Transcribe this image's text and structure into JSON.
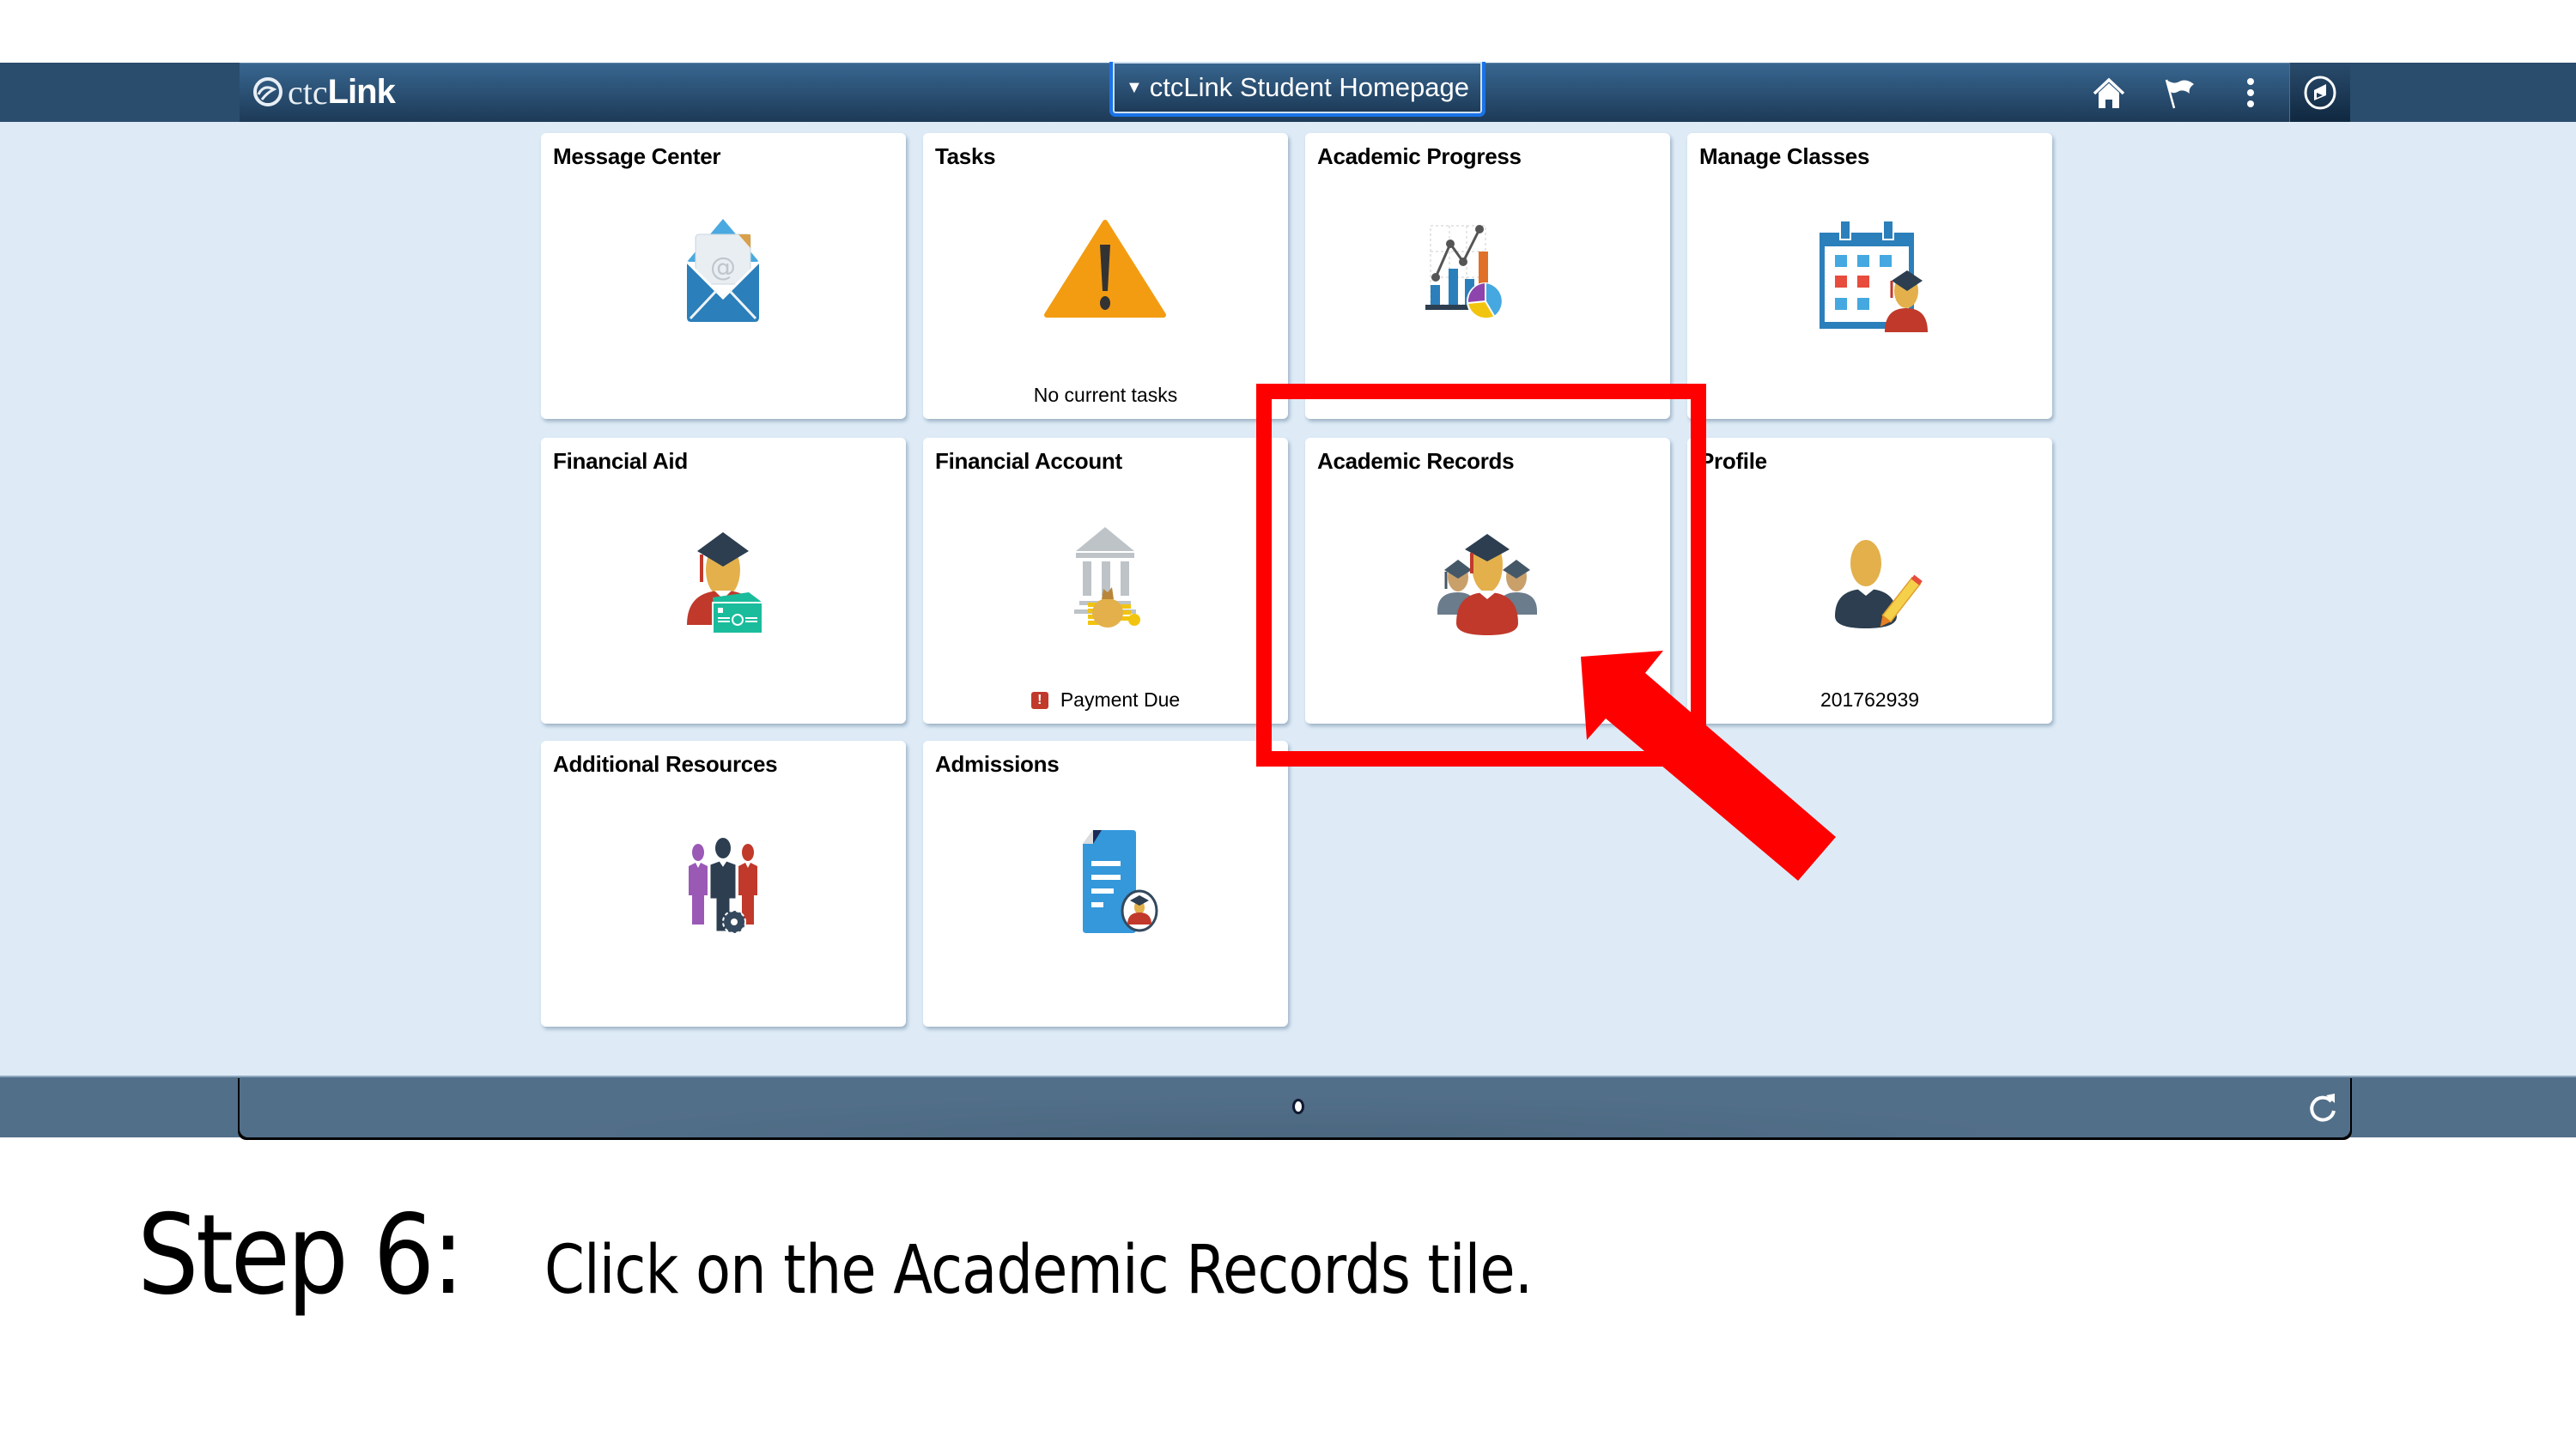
{
  "header": {
    "logo_swirl": "Θ",
    "logo_prefix": "ctc",
    "logo_suffix": "Link",
    "homepage_selector": "ctcLink Student Homepage",
    "icons": [
      "home-icon",
      "flag-icon",
      "actions-menu-icon",
      "navbar-compass-icon"
    ]
  },
  "tiles": [
    {
      "title": "Message Center",
      "icon": "envelope-icon",
      "footer": ""
    },
    {
      "title": "Tasks",
      "icon": "warning-icon",
      "footer": "No current tasks"
    },
    {
      "title": "Academic Progress",
      "icon": "chart-icon",
      "footer": ""
    },
    {
      "title": "Manage Classes",
      "icon": "calendar-student-icon",
      "footer": ""
    },
    {
      "title": "Financial Aid",
      "icon": "graduate-money-icon",
      "footer": ""
    },
    {
      "title": "Financial Account",
      "icon": "bank-icon",
      "footer": "Payment Due",
      "footer_alert": "!"
    },
    {
      "title": "Academic Records",
      "icon": "graduates-icon",
      "footer": ""
    },
    {
      "title": "Profile",
      "icon": "profile-edit-icon",
      "footer": "201762939"
    },
    {
      "title": "Additional Resources",
      "icon": "people-gear-icon",
      "footer": ""
    },
    {
      "title": "Admissions",
      "icon": "document-graduate-icon",
      "footer": ""
    }
  ],
  "footer": {
    "page_indicator": {
      "current": 1,
      "total": 1
    },
    "refresh_icon": "refresh-icon"
  },
  "annotation": {
    "highlight_target": "Academic Records",
    "color": "#ff0000"
  },
  "caption": {
    "step": "Step 6:",
    "text": "Click on the Academic Records tile."
  },
  "colors": {
    "header": "#2a4d6e",
    "background": "#deebf7",
    "footer": "#526f89",
    "selector_border": "#1a73e8"
  }
}
